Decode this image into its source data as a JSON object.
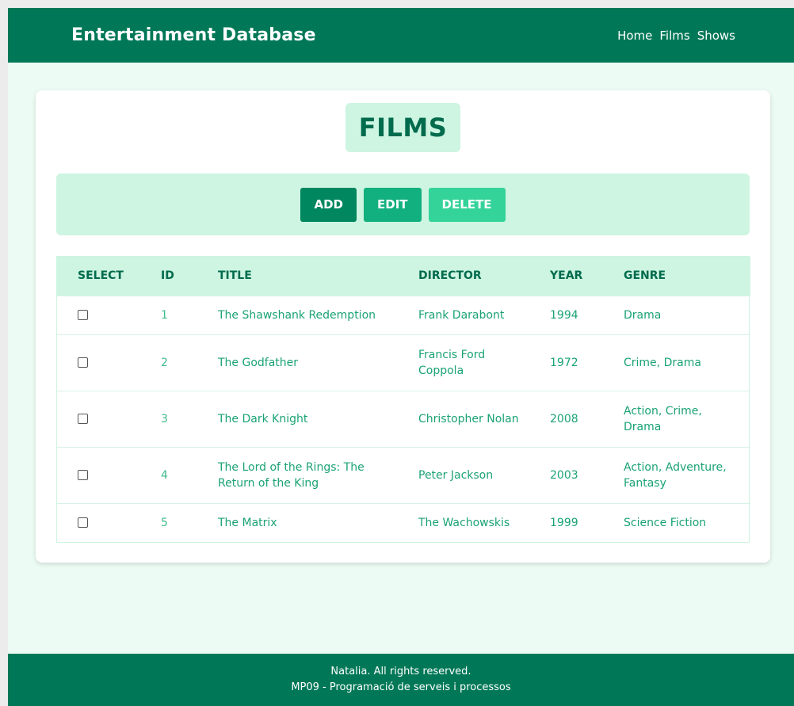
{
  "brand": "Entertainment Database",
  "nav": [
    "Home",
    "Films",
    "Shows"
  ],
  "page_title": "FILMS",
  "toolbar": {
    "add_label": "ADD",
    "edit_label": "EDIT",
    "delete_label": "DELETE"
  },
  "table": {
    "headers": [
      "SELECT",
      "ID",
      "TITLE",
      "DIRECTOR",
      "YEAR",
      "GENRE"
    ],
    "rows": [
      {
        "id": "1",
        "title": "The Shawshank Redemption",
        "director": "Frank Darabont",
        "year": "1994",
        "genre": "Drama"
      },
      {
        "id": "2",
        "title": "The Godfather",
        "director": "Francis Ford Coppola",
        "year": "1972",
        "genre": "Crime, Drama"
      },
      {
        "id": "3",
        "title": "The Dark Knight",
        "director": "Christopher Nolan",
        "year": "2008",
        "genre": "Action, Crime, Drama"
      },
      {
        "id": "4",
        "title": "The Lord of the Rings: The Return of the King",
        "director": "Peter Jackson",
        "year": "2003",
        "genre": "Action, Adventure, Fantasy"
      },
      {
        "id": "5",
        "title": "The Matrix",
        "director": "The Wachowskis",
        "year": "1999",
        "genre": "Science Fiction"
      }
    ]
  },
  "footer": {
    "line1": "Natalia. All rights reserved.",
    "line2": "MP09 - Programació de serveis i processos"
  },
  "colors": {
    "primary": "#007857",
    "light_accent": "#cdf5e1",
    "page_background": "#ecfbf4",
    "add": "#00875f",
    "edit": "#12b07e",
    "delete": "#34d39a",
    "cell_text": "#1aa373"
  }
}
